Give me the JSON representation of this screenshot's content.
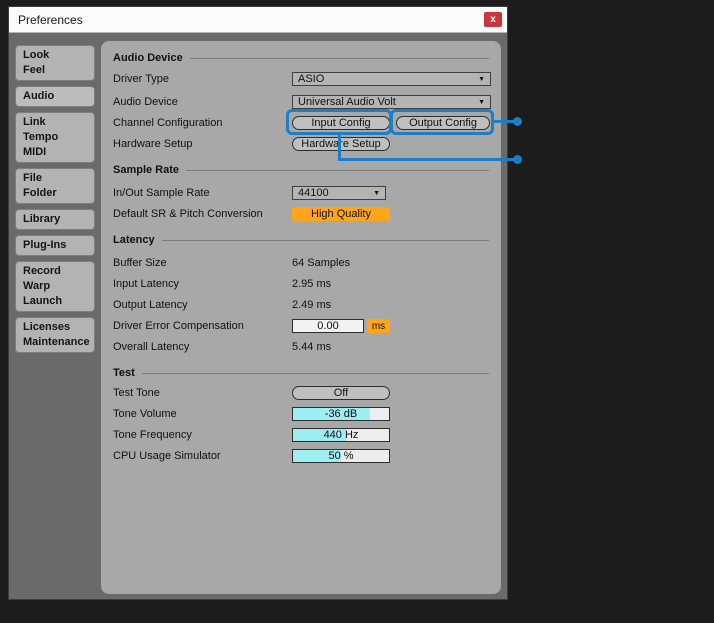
{
  "window": {
    "title": "Preferences",
    "close_glyph": "x"
  },
  "icons": {
    "dropdown_caret": "▼"
  },
  "sidebar": {
    "selected_tab": "Audio",
    "tabs": [
      {
        "lines": [
          "Look",
          "Feel"
        ]
      },
      {
        "lines": [
          "Audio"
        ]
      },
      {
        "lines": [
          "Link",
          "Tempo",
          "MIDI"
        ]
      },
      {
        "lines": [
          "File",
          "Folder"
        ]
      },
      {
        "lines": [
          "Library"
        ]
      },
      {
        "lines": [
          "Plug-Ins"
        ]
      },
      {
        "lines": [
          "Record",
          "Warp",
          "Launch"
        ]
      },
      {
        "lines": [
          "Licenses",
          "Maintenance"
        ]
      }
    ]
  },
  "audio_device": {
    "header": "Audio Device",
    "driver_type": {
      "label": "Driver Type",
      "value": "ASIO"
    },
    "device": {
      "label": "Audio Device",
      "value": "Universal Audio Volt"
    },
    "channel_config": {
      "label": "Channel Configuration",
      "input_button": "Input Config",
      "output_button": "Output Config"
    },
    "hardware": {
      "label": "Hardware Setup",
      "button": "Hardware Setup"
    }
  },
  "sample_rate": {
    "header": "Sample Rate",
    "in_out": {
      "label": "In/Out Sample Rate",
      "value": "44100"
    },
    "conversion": {
      "label": "Default SR & Pitch Conversion",
      "value": "High Quality"
    }
  },
  "latency": {
    "header": "Latency",
    "buffer_size": {
      "label": "Buffer Size",
      "value": "64 Samples"
    },
    "input": {
      "label": "Input Latency",
      "value": "2.95 ms"
    },
    "output": {
      "label": "Output Latency",
      "value": "2.49 ms"
    },
    "driver_error": {
      "label": "Driver Error Compensation",
      "value": "0.00",
      "unit": "ms"
    },
    "overall": {
      "label": "Overall Latency",
      "value": "5.44 ms"
    }
  },
  "test": {
    "header": "Test",
    "test_tone": {
      "label": "Test Tone",
      "value": "Off"
    },
    "tone_volume": {
      "label": "Tone Volume",
      "value": "-36 dB",
      "fill_percent": 80
    },
    "tone_frequency": {
      "label": "Tone Frequency",
      "value": "440 Hz",
      "fill_percent": 55
    },
    "cpu_usage": {
      "label": "CPU Usage Simulator",
      "value": "50 %",
      "fill_percent": 50
    }
  },
  "colors": {
    "accent_orange": "#ffa519",
    "slider_cyan": "#9deef0",
    "annotation_blue": "#1a7ec8",
    "close_red": "#c8373b"
  }
}
